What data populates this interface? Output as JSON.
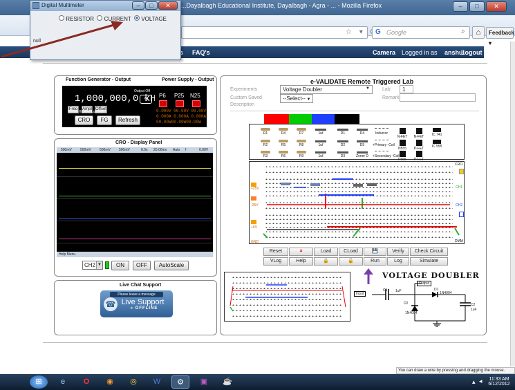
{
  "browser": {
    "title": "...Dayalbagh Educational Institute, Dayalbagh - Agra - ... - Mozilla Firefox",
    "search_placeholder": "Google",
    "search_engine_icon": "G",
    "feedback_label": "Feedback",
    "home_icon": "⌂",
    "search_icon": "⌕",
    "url_icons": "☆ ▾ C"
  },
  "multimeter": {
    "title": "Digital Multimeter",
    "options": [
      "RESISTOR",
      "CURRENT",
      "VOLTAGE"
    ],
    "selected": "VOLTAGE",
    "status": "null"
  },
  "site_nav": {
    "left_fragment": "s",
    "faqs": "FAQ's",
    "camera": "Camera",
    "logged_in_prefix": "Logged in as",
    "user": "anshul",
    "logout": "Logout"
  },
  "function_generator": {
    "title": "Function Generator - Output",
    "output_label": "Output Off",
    "frequency": "1,000,000,0 kHz",
    "small_buttons": [
      "Freq",
      "Ampl",
      "Offset"
    ],
    "small_labels": [
      "Period",
      "HiLevel",
      "LoLevel"
    ],
    "buttons": [
      "CRO",
      "FG",
      "Refresh"
    ]
  },
  "power_supply": {
    "title": "Power Supply - Output",
    "channels": [
      "P6",
      "P25",
      "N25"
    ],
    "voltage_row": "0.000V 00.00V 00.00V",
    "current_row": "0.000A 0.000A 0.000A",
    "power_row": "00.00W00.00W00.00W"
  },
  "cro": {
    "title": "CRO - Display Panel",
    "toolbar": [
      "500mV",
      "500mV",
      "500mV",
      "500mV",
      "0.0s",
      "20.00ms",
      "Auto",
      "f",
      "0.00V"
    ],
    "status": "Help Menu",
    "channel": "CH2",
    "buttons": [
      "ON",
      "OFF",
      "AutoScale"
    ],
    "trace_colors": [
      "#d8c838",
      "#3cc13c",
      "#3b5fd9",
      "#d23f8c"
    ]
  },
  "live_chat": {
    "title": "Live Chat Support",
    "leave_message": "Please leave a message",
    "live_support": "Live Support",
    "offline": "OFFLINE"
  },
  "evalidate": {
    "title": "e-VALIDATE Remote Triggered Lab",
    "experiments_label": "Experiments",
    "experiment_value": "Voltage Doubler",
    "custom_saved_label": "Custom Saved",
    "custom_saved_value": "--Select--",
    "description_label": "Description",
    "lab_label": "Lab",
    "lab_value": "1",
    "remark_label": "Remark",
    "color_swatches": [
      "#ff0000",
      "#00cc00",
      "#1f3fff",
      "#000000"
    ],
    "components": [
      {
        "label": "R1"
      },
      {
        "label": "R4"
      },
      {
        "label": "R7"
      },
      {
        "label": "1uf"
      },
      {
        "label": "D1"
      },
      {
        "label": "D4"
      },
      {
        "label": "Inductor"
      },
      {
        "label": "N-FET"
      },
      {
        "label": "N-FET"
      },
      {
        "label": "IC 741"
      },
      {
        "label": "R2"
      },
      {
        "label": "R5"
      },
      {
        "label": "R8"
      },
      {
        "label": "1uf"
      },
      {
        "label": "D2"
      },
      {
        "label": "D5"
      },
      {
        "label": "+Primary -Coil"
      },
      {
        "label": "N555"
      },
      {
        "label": "P-FET"
      },
      {
        "label": "IC 555"
      },
      {
        "label": "R3"
      },
      {
        "label": "R6"
      },
      {
        "label": "R9"
      },
      {
        "label": "1uf"
      },
      {
        "label": "D3"
      },
      {
        "label": "Zener D"
      },
      {
        "label": "+Secondary -Coil"
      },
      {
        "label": "P555"
      },
      {
        "label": "P-FET"
      }
    ],
    "board_labels_left": [
      "+25V",
      "-25V",
      "+6V",
      "GND"
    ],
    "board_labels_right": [
      "CRO",
      "CH1",
      "CH2",
      "DMM"
    ],
    "control_buttons": [
      "Reset",
      "×",
      "Load",
      "CLoad",
      "💾",
      "Verify",
      "Check Circuit",
      "VLog",
      "Help",
      "🔒",
      "🔓",
      "Run",
      "Log",
      "Simulate"
    ],
    "circuit_title": "VOLTAGE DOUBLER",
    "circuit_labels": {
      "input": "Input",
      "output": "Output",
      "c1": "C1",
      "c1_val": "1uF",
      "d1": "D1",
      "d1_part": "1N4004",
      "d2": "D2",
      "d2_part": "1N4004",
      "c2": "C2",
      "c2_val": "1uF"
    }
  },
  "status_tip": "You can draw a wire by pressing and dragging the mouse.",
  "taskbar": {
    "time": "11:33 AM",
    "date": "6/12/2012"
  }
}
